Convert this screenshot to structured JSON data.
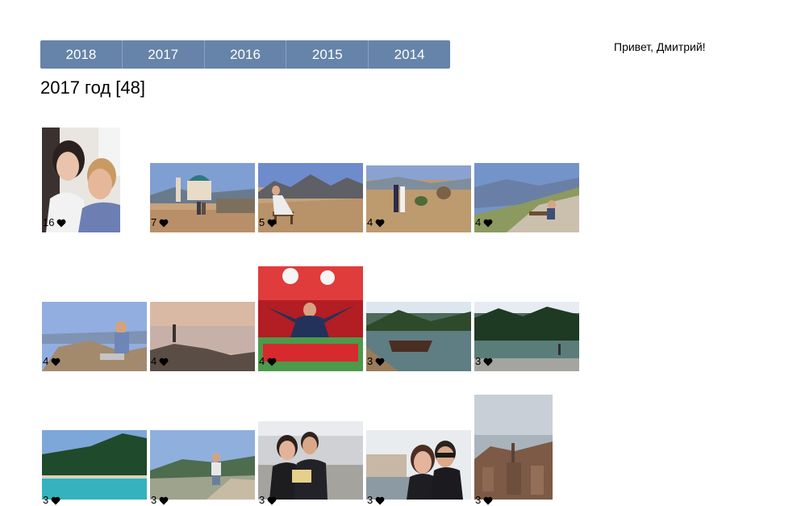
{
  "tabs": [
    {
      "label": "2018"
    },
    {
      "label": "2017"
    },
    {
      "label": "2016"
    },
    {
      "label": "2015"
    },
    {
      "label": "2014"
    }
  ],
  "greeting": "Привет, Дмитрий!",
  "year_title": "2017 год [48]",
  "photos": [
    {
      "likes": "16",
      "scene": "selfie-couple"
    },
    {
      "likes": "7",
      "scene": "church-island"
    },
    {
      "likes": "5",
      "scene": "mountain-bench"
    },
    {
      "likes": "4",
      "scene": "steppe-couple"
    },
    {
      "likes": "4",
      "scene": "fjord-view"
    },
    {
      "likes": "4",
      "scene": "coast-rocks-man"
    },
    {
      "likes": "4",
      "scene": "sunset-rocks"
    },
    {
      "likes": "4",
      "scene": "football-collage"
    },
    {
      "likes": "3",
      "scene": "lake-boat"
    },
    {
      "likes": "3",
      "scene": "mountain-lake"
    },
    {
      "likes": "3",
      "scene": "forest-lake"
    },
    {
      "likes": "3",
      "scene": "bay-hills"
    },
    {
      "likes": "3",
      "scene": "airport-selfie"
    },
    {
      "likes": "3",
      "scene": "venice-selfie"
    },
    {
      "likes": "3",
      "scene": "venice-rooftops"
    }
  ],
  "colors": {
    "tab_bar": "#6683a9",
    "tab_divider": "#8aa2c1"
  }
}
